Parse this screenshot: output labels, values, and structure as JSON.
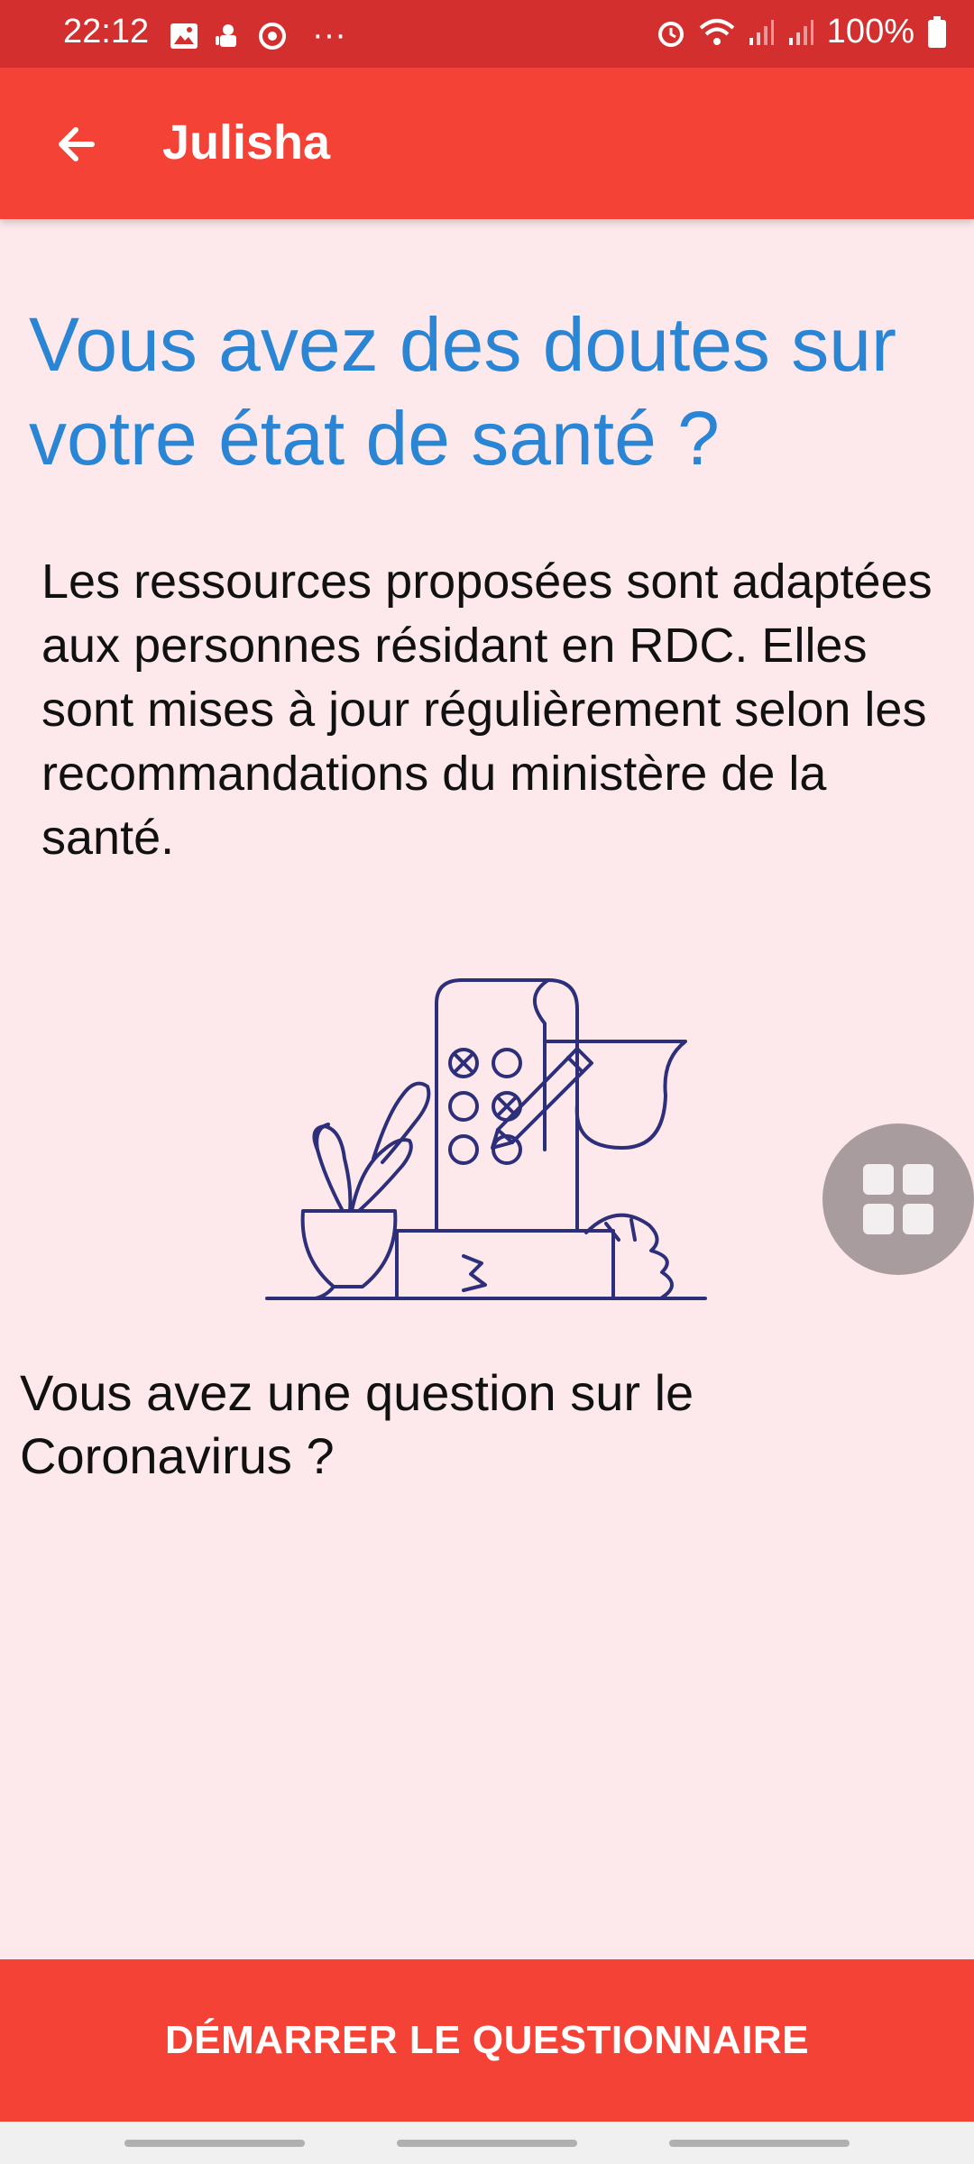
{
  "status_bar": {
    "time": "22:12",
    "left_icons": [
      "gallery-icon",
      "android-icon",
      "sync-icon"
    ],
    "more": "···",
    "battery": "100%",
    "right_icons": [
      "alarm-icon",
      "wifi-icon",
      "signal-icon",
      "signal-icon",
      "battery-icon"
    ]
  },
  "app_bar": {
    "title": "Julisha",
    "back_icon": "arrow-left-icon"
  },
  "main": {
    "headline": "Vous avez des doutes sur votre état de santé ?",
    "intro": "Les ressources proposées sont adaptées aux personnes résidant en RDC. Elles sont mises à jour régulièrement selon les recommandations du ministère de la santé.",
    "question": "Vous avez une question sur le Coronavirus ?"
  },
  "floating_button": {
    "icon": "grid-icon"
  },
  "cta": {
    "label": "DÉMARRER LE QUESTIONNAIRE"
  },
  "colors": {
    "status_bar": "#d32f2f",
    "app_bar": "#f44336",
    "background": "#fde9ec",
    "headline": "#2a86d4",
    "illustration": "#2d2f7a"
  }
}
